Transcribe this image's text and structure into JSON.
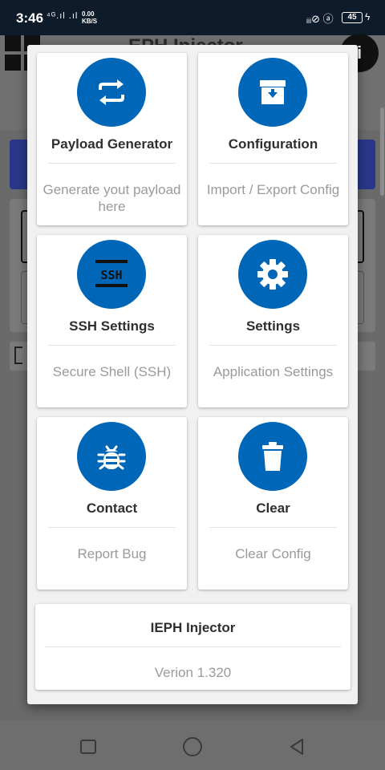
{
  "status_bar": {
    "time": "3:46",
    "signal": "⁴ᴳ.ıl .ıl",
    "speed_value": "0.00",
    "speed_unit": "KB/S",
    "icons": "ᵢᵢᵢ⊘ ⓐ",
    "battery": "45"
  },
  "background": {
    "title": "EPH Injector",
    "avatar_letter": "i"
  },
  "menu": {
    "cards": [
      {
        "title": "Payload Generator",
        "subtitle": "Generate yout payload here",
        "icon": "swap-arrows-icon"
      },
      {
        "title": "Configuration",
        "subtitle": "Import / Export Config",
        "icon": "archive-box-icon"
      },
      {
        "title": "SSH Settings",
        "subtitle": "Secure Shell (SSH)",
        "icon": "ssh-icon"
      },
      {
        "title": "Settings",
        "subtitle": "Application Settings",
        "icon": "gear-icon"
      },
      {
        "title": "Contact",
        "subtitle": "Report Bug",
        "icon": "bug-icon"
      },
      {
        "title": "Clear",
        "subtitle": "Clear Config",
        "icon": "trash-icon"
      }
    ],
    "ssh_label": "SSH",
    "about": {
      "title": "IEPH Injector",
      "version": "Verion 1.320"
    }
  },
  "colors": {
    "accent": "#0066b8",
    "status_bar": "#0e1b2b"
  }
}
